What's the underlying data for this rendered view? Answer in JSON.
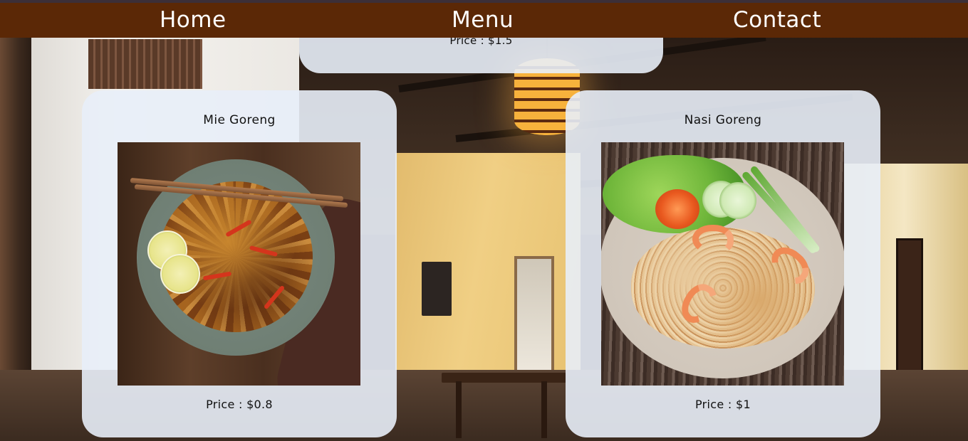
{
  "nav": {
    "home": "Home",
    "menu": "Menu",
    "contact": "Contact"
  },
  "menu": {
    "items": [
      {
        "name": "",
        "price": "Price : $1.5"
      },
      {
        "name": "Mie Goreng",
        "price": "Price : $0.8"
      },
      {
        "name": "Nasi Goreng",
        "price": "Price : $1"
      }
    ]
  },
  "colors": {
    "navbar": "#5b2806",
    "card": "#e8eef8"
  }
}
